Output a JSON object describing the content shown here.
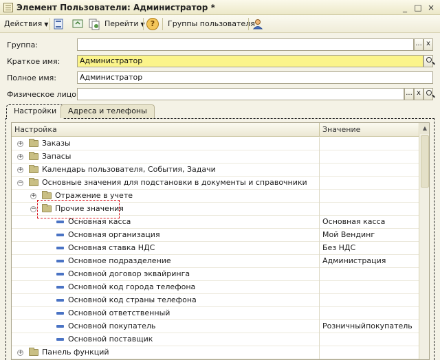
{
  "window": {
    "title": "Элемент Пользователи: Администратор *",
    "buttons": [
      "_",
      "□",
      "×"
    ]
  },
  "toolbar": {
    "actions_label": "Действия",
    "goto_label": "Перейти",
    "help_label": "?",
    "user_groups_label": "Группы пользователя"
  },
  "form": {
    "group_label": "Группа:",
    "group_value": "",
    "short_name_label": "Краткое имя:",
    "short_name_value": "Администратор",
    "full_name_label": "Полное имя:",
    "full_name_value": "Администратор",
    "person_label": "Физическое лицо:",
    "person_value": "",
    "dots": "...",
    "clear": "x"
  },
  "tabs": [
    {
      "label": "Настройки",
      "active": true
    },
    {
      "label": "Адреса и телефоны",
      "active": false
    }
  ],
  "table": {
    "col_setting": "Настройка",
    "col_value": "Значение",
    "rows": [
      {
        "label": "Заказы",
        "value": "",
        "type": "folder",
        "level": 0,
        "toggle": "+"
      },
      {
        "label": "Запасы",
        "value": "",
        "type": "folder",
        "level": 0,
        "toggle": "+"
      },
      {
        "label": "Календарь пользователя, События, Задачи",
        "value": "",
        "type": "folder",
        "level": 0,
        "toggle": "+"
      },
      {
        "label": "Основные значения для подстановки в документы и справочники",
        "value": "",
        "type": "folder",
        "level": 0,
        "toggle": "−"
      },
      {
        "label": "Отражение в учете",
        "value": "",
        "type": "folder",
        "level": 1,
        "toggle": "+"
      },
      {
        "label": "Прочие значения",
        "value": "",
        "type": "folder",
        "level": 1,
        "toggle": "−"
      },
      {
        "label": "Основная касса",
        "value": "Основная касса",
        "type": "item",
        "level": 2
      },
      {
        "label": "Основная организация",
        "value": "Мой Вендинг",
        "type": "item",
        "level": 2
      },
      {
        "label": "Основная ставка НДС",
        "value": "Без НДС",
        "type": "item",
        "level": 2
      },
      {
        "label": "Основное подразделение",
        "value": "Администрация",
        "type": "item",
        "level": 2
      },
      {
        "label": "Основной договор эквайринга",
        "value": "",
        "type": "item",
        "level": 2
      },
      {
        "label": "Основной код города телефона",
        "value": "",
        "type": "item",
        "level": 2
      },
      {
        "label": "Основной код страны телефона",
        "value": "",
        "type": "item",
        "level": 2
      },
      {
        "label": "Основной ответственный",
        "value": "",
        "type": "item",
        "level": 2
      },
      {
        "label": "Основной покупатель",
        "value": "Розничныйпокупатель",
        "type": "item",
        "level": 2
      },
      {
        "label": "Основной поставщик",
        "value": "",
        "type": "item",
        "level": 2
      },
      {
        "label": "Панель функций",
        "value": "",
        "type": "folder",
        "level": 0,
        "toggle": "+"
      }
    ]
  },
  "colors": {
    "highlight_border": "#d8141e",
    "yellow_field": "#fbf48a",
    "item_icon": "#4a73c4"
  }
}
